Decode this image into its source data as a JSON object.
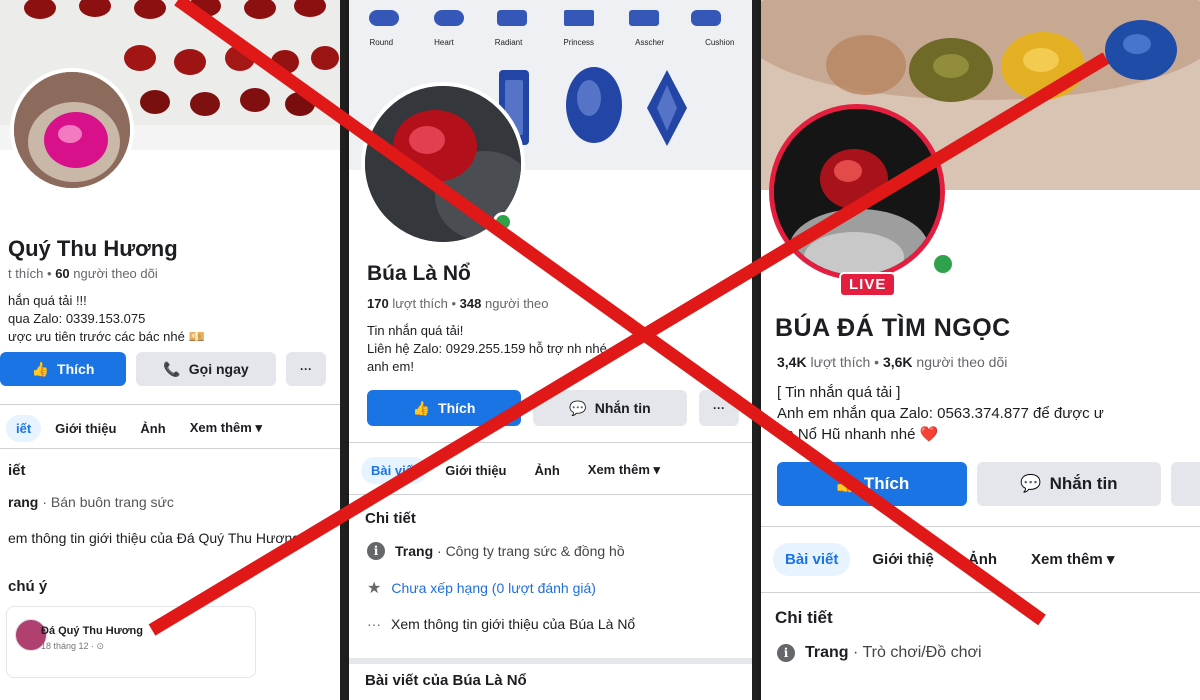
{
  "panels": {
    "p1": {
      "page_name": "Quý Thu Hương",
      "stats_text": "t thích  •",
      "followers_count": "60",
      "followers_label": "người theo dõi",
      "bio": [
        "hắn quá tải !!!",
        "qua Zalo: 0339.153.075",
        "ược ưu tiên trước các bác nhé 💴"
      ],
      "like_button": "Thích",
      "call_button": "Gọi ngay",
      "more_button": "···",
      "tabs": [
        "iết",
        "Giới thiệu",
        "Ảnh",
        "Xem thêm ▾"
      ],
      "details_title": "iết",
      "category_prefix": "rang",
      "category_text": "· Bán buôn trang sức",
      "see_about": "em thông tin giới thiệu của Đá Quý Thu Hương",
      "notice_title": "chú ý",
      "post_author": "Đá Quý Thu Hương",
      "post_time": "18 tháng 12 · ⊙"
    },
    "p2": {
      "shape_labels": [
        "Round",
        "Heart",
        "Radiant",
        "Princess",
        "Asscher",
        "Cushion"
      ],
      "page_name": "Búa Là Nổ",
      "likes_count": "170",
      "likes_label": "lượt thích",
      "dot": "•",
      "followers_count": "348",
      "followers_label": "người theo",
      "bio": [
        "Tin nhắn quá tải!",
        "Liên hệ Zalo: 0929.255.159 hỗ trợ    nh nhé",
        "anh em!"
      ],
      "like_button": "Thích",
      "message_button": "Nhắn tin",
      "more_button": "···",
      "tabs": [
        "Bài viết",
        "Giới thiệu",
        "Ảnh",
        "Xem thêm ▾"
      ],
      "details_title": "Chi tiết",
      "category_prefix": "Trang",
      "category_text": "· Công ty trang sức & đồng hồ",
      "rating_text": "Chưa xếp hạng (0 lượt đánh giá)",
      "see_about": "Xem thông tin giới thiệu của Búa Là Nổ",
      "posts_title": "Bài viết của Búa Là Nổ"
    },
    "p3": {
      "live_badge": "LIVE",
      "page_name": "BÚA ĐÁ TÌM NGỌC",
      "likes_count": "3,4K",
      "likes_label": "lượt thích",
      "dot": "•",
      "followers_count": "3,6K",
      "followers_label": "người theo dõi",
      "bio": [
        "[ Tin nhắn quá tải ]",
        "Anh em nhắn qua Zalo: 0563.374.877 để được ư",
        "ăn Nổ Hũ nhanh nhé ❤️"
      ],
      "like_button": "Thích",
      "message_button": "Nhắn tin",
      "tabs": [
        "Bài viết",
        "Giới thiệ",
        "Ảnh",
        "Xem thêm ▾"
      ],
      "details_title": "Chi tiết",
      "category_prefix": "Trang",
      "category_text": "· Trò chơi/Đồ chơi"
    }
  },
  "colors": {
    "facebook_blue": "#1b74e4",
    "cross_red": "#e01818",
    "online_green": "#31a24c",
    "live_red": "#e41e3f"
  }
}
